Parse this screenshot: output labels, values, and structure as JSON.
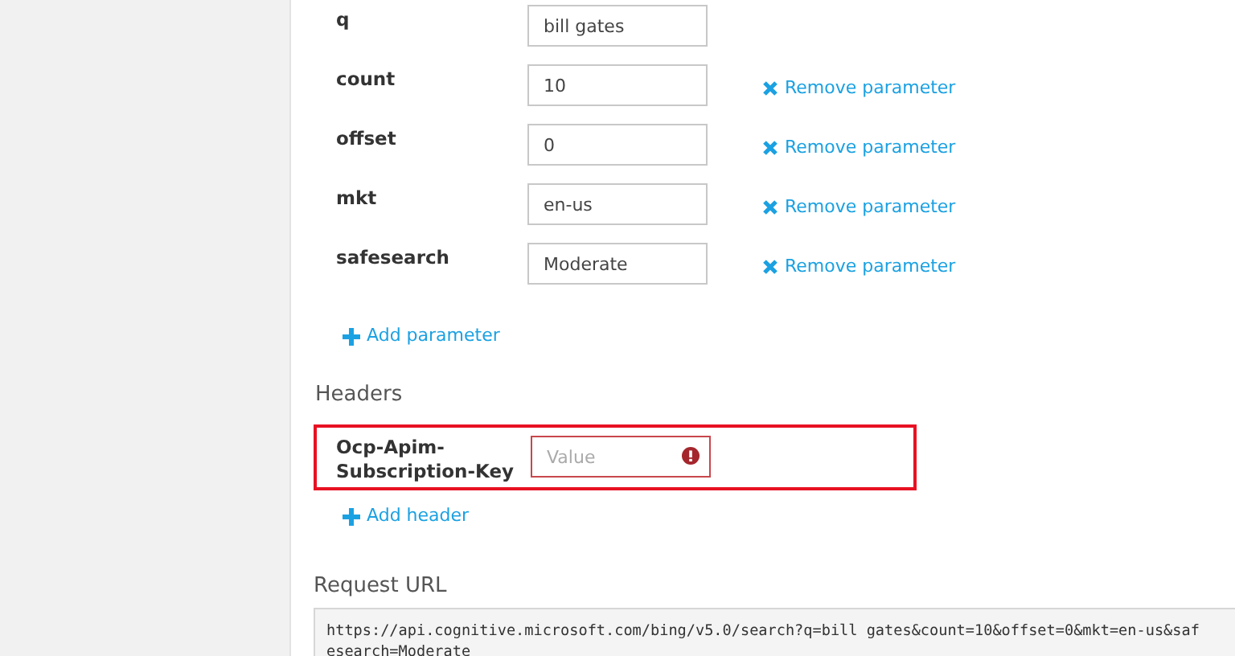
{
  "parameters": [
    {
      "name": "q",
      "value": "bill gates",
      "removable": false
    },
    {
      "name": "count",
      "value": "10",
      "removable": true,
      "remove_label": "Remove parameter"
    },
    {
      "name": "offset",
      "value": "0",
      "removable": true,
      "remove_label": "Remove parameter"
    },
    {
      "name": "mkt",
      "value": "en-us",
      "removable": true,
      "remove_label": "Remove parameter"
    },
    {
      "name": "safesearch",
      "value": "Moderate",
      "removable": true,
      "remove_label": "Remove parameter"
    }
  ],
  "add_parameter": "Add parameter",
  "headers": {
    "title": "Headers",
    "items": [
      {
        "name_lines": [
          "Ocp-Apim-",
          "Subscription-Key"
        ],
        "placeholder": "Value",
        "error": true,
        "highlighted": true
      }
    ],
    "add_header": "Add header"
  },
  "request_url": {
    "title": "Request URL",
    "url": "https://api.cognitive.microsoft.com/bing/v5.0/search?q=bill gates&count=10&offset=0&mkt=en-us&safesearch=Moderate"
  }
}
